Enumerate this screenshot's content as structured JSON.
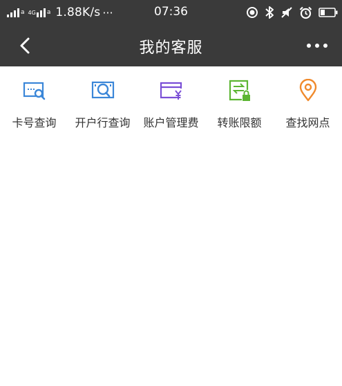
{
  "status_bar": {
    "network_speed": "1.88K/s",
    "dots": "···",
    "sim1_type": "a",
    "sim2_tag": "4G",
    "sim2_type": "a",
    "time": "07:36",
    "icons": [
      "location-icon",
      "bluetooth-icon",
      "mute-icon",
      "alarm-icon",
      "battery-icon"
    ]
  },
  "nav": {
    "title": "我的客服",
    "back_icon": "chevron-left-icon",
    "more_icon": "more-dots-icon"
  },
  "shortcuts": [
    {
      "label": "卡号查询",
      "icon": "card-search-icon",
      "color": "#3a86d8"
    },
    {
      "label": "开户行查询",
      "icon": "bank-search-icon",
      "color": "#3a86d8"
    },
    {
      "label": "账户管理费",
      "icon": "account-fee-icon",
      "color": "#7a4fd6"
    },
    {
      "label": "转账限额",
      "icon": "transfer-limit-icon",
      "color": "#5cb532"
    },
    {
      "label": "查找网点",
      "icon": "location-pin-icon",
      "color": "#f08a2c"
    }
  ]
}
